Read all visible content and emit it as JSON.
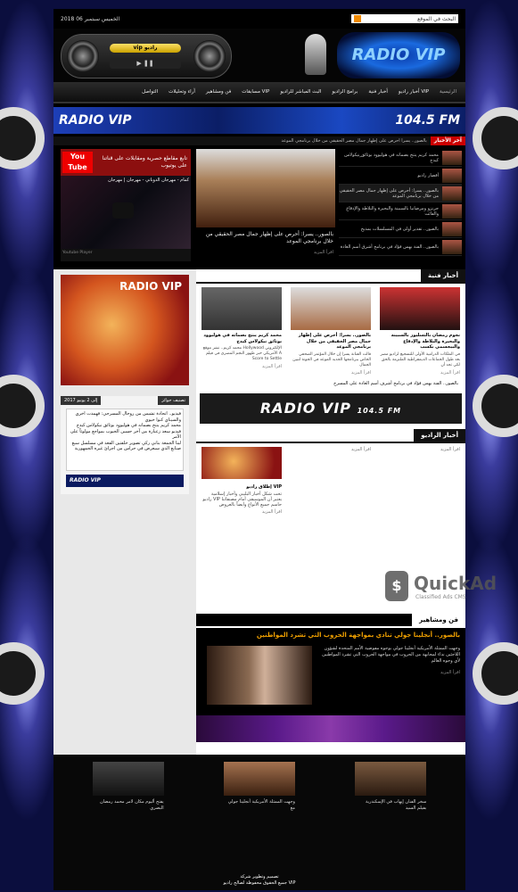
{
  "topbar": {
    "date": "الخميس سبتمبر 06 2018",
    "search_placeholder": "البحث في الموقع"
  },
  "player": {
    "station_label": "vip راديو",
    "controls": "▶ ❚❚"
  },
  "logo": {
    "text": "RADIO VIP"
  },
  "nav": {
    "items": [
      {
        "label": "الرئيسية",
        "active": true
      },
      {
        "label": "أخبار راديو VIP"
      },
      {
        "label": "أخبار فنية"
      },
      {
        "label": "برامج الراديو"
      },
      {
        "label": "البث المباشر للراديو"
      },
      {
        "label": "مسابقات VIP"
      },
      {
        "label": "فن ومشاهير"
      },
      {
        "label": "آراء وتحليلات"
      },
      {
        "label": "التواصل"
      }
    ]
  },
  "banner": {
    "text": "RADIO VIP",
    "freq": "104.5 FM"
  },
  "ticker": {
    "label": "آخر الأخبار",
    "text": "بالصور.. يسرا أحرص على إظهار جمال مصر الحقيقي من خلال برنامجي الموعد"
  },
  "youtube": {
    "logo": "You Tube",
    "subtitle": "تابع مقاطع حصرية ومقابلات على قناتنا على يوتيوب",
    "video_title": "كمام - مهرجان الدوباتي - مهرجان | مهرجان",
    "footer": "Youtube Player"
  },
  "featured": {
    "title": "بالصور.. يسرا: أحرص على إظهار جمال مصر الحقيقي من خلال برنامجي الموعد",
    "more": "اقرأ المزيد"
  },
  "side_news": [
    "محمد كريم ينتج بصماته في هوليوود بوثائق ٍنيكولاس كيدج",
    "أقصار راديو",
    "بالصور.. يسرا: أحرص على إظهار جمال مصر الحقيقي من خلال برنامجي الموعد",
    "جرنزو ومرضانيا بالسبينة والبحيرة والبلاطة والإدقاع والفائت",
    "بالصور.. تقدير أولى في المسلسلات بمديح",
    "بالصور.. الفنة بهس فؤاد في برنامج أشرق أسم العادة"
  ],
  "radio_box": {
    "text": "RADIO VIP"
  },
  "poll": {
    "tab1": "تصنيف جوائز",
    "tab2": "2017 إلى 2 يونيو",
    "items": [
      "فيديو.. اتحادة تشيس من روحال المسرحي: فهمدت اخري والسيناي كنوا حيوي",
      "محمد كريم ينتج بصماته في هوليوود بوثائق نيكولاس كيدج",
      "فيديو سعد زعبارة من آخر حسين الجبوب بمواجع مولوثاً على الأمر",
      "لبنا الجمعة بناني ركي تصوير حلقتين الفعد في مسلسل سبع صنايع الذي سيعرض في حراس من اجرائ غيره الجمهورية"
    ],
    "footer": "RADIO VIP"
  },
  "art_news": {
    "header": "أخبار فنية",
    "cards": [
      {
        "title": "نجوم رمضان بالتسليوز بالسبينة والبحيرة والبلاطة والإدقاع والبيجسمي بكسب",
        "excerpt": "في الملكات الدرامية الأولى للتسجيع لراديو مصر بعد طول الجماعات الديمقراطية الملتزمة بالحق لكي تجد أن",
        "more": "اقرأ المزيد"
      },
      {
        "title": "بالصور.. يسرا: أحرص على إظهار جمال مصر الحقيقي من خلال برنامجي الموعد",
        "excerpt": "قالت الفنانة يسرا إن خلال المؤتمر الصحفي الخاص ببرنامجها الجديد الموعد في الجونة لتبين الجمال",
        "more": "اقرأ المزيد"
      },
      {
        "title": "محمد كريم ينتج بصماته في هوليوود بوثائق نيكولاس كيدج",
        "excerpt": "محمد كريم.. نشر موقع Hollywood الإلكتروني الأمريكي خبر ظهور النجم المصري في فيلم A Score to Settle",
        "more": "اقرأ المزيد"
      }
    ],
    "bullet": "بالصور.. الفنة بهس فؤاد في برنامج أشرف أسم العادة على المسرح"
  },
  "banner2": {
    "text": "RADIO VIP",
    "freq": "104.5 FM"
  },
  "radio_news": {
    "header": "أخبار الراديو",
    "col1_more": "اقرأ المزيد",
    "col2_more": "اقرأ المزيد",
    "col3_title": "إطلاق راديو VIP",
    "col3_text": "تحت شكل أخبار البليبي وأخبار إسلامية راديو VIP يعتبر أن الموسيقى أمام مصنفاتنا حاسم جميع الأنواع وأيضاً بالعروض",
    "col3_more": "اقرأ المزيد"
  },
  "fame": {
    "header": "فن ومشاهير",
    "title": "بالصور.. أنجلينا جولي تنادي بمواجهة الحروب التي تشرد المواطنين",
    "text": "وجهت الممثلة الأمريكية أنجلينا جولي بوجوه مفوضية الأمم المتحدة لشؤون اللاجئين نداء لمجابهة من الحروب في مواجهة الحروب التي تشرد المواطنين لأي وجوه العالم",
    "more": "اقرأ المزيد"
  },
  "footer_cards": [
    {
      "title": "سخر الفنان إيهاب في الإسكندرية بفيلم السيد"
    },
    {
      "title": "وجهت الممثلة الأمريكية أنجلينا جولي مع"
    },
    {
      "title": "يفتح أليوم مكان لامر محمد رمضان البصري"
    }
  ],
  "footer": {
    "line1": "جميع الحقوق محفوظة لصالح راديو VIP",
    "line2": "تصميم وتطوير شركة"
  },
  "watermark": {
    "brand": "QuickAd",
    "tagline": "Classified Ads CMS"
  }
}
